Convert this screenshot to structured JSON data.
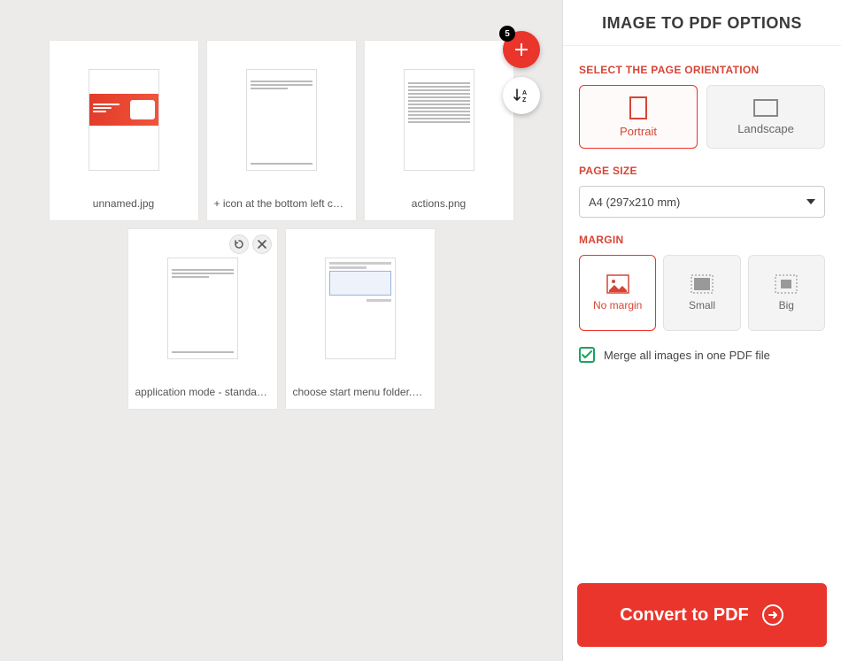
{
  "files": {
    "count_badge": "5",
    "items": [
      {
        "name": "unnamed.jpg",
        "preview": "hero"
      },
      {
        "name": "+ icon at the bottom left corner...",
        "preview": "doc"
      },
      {
        "name": "actions.png",
        "preview": "table"
      },
      {
        "name": "application mode - standard p...",
        "preview": "doc",
        "showActions": true
      },
      {
        "name": "choose start menu folder.png",
        "preview": "installer"
      }
    ]
  },
  "panel": {
    "title": "IMAGE TO PDF OPTIONS",
    "orientation": {
      "label": "SELECT THE PAGE ORIENTATION",
      "portrait": "Portrait",
      "landscape": "Landscape"
    },
    "pageSize": {
      "label": "PAGE SIZE",
      "value": "A4 (297x210 mm)"
    },
    "margin": {
      "label": "MARGIN",
      "none": "No margin",
      "small": "Small",
      "big": "Big"
    },
    "merge": {
      "label": "Merge all images in one PDF file",
      "checked": true
    },
    "convert": "Convert to PDF"
  }
}
